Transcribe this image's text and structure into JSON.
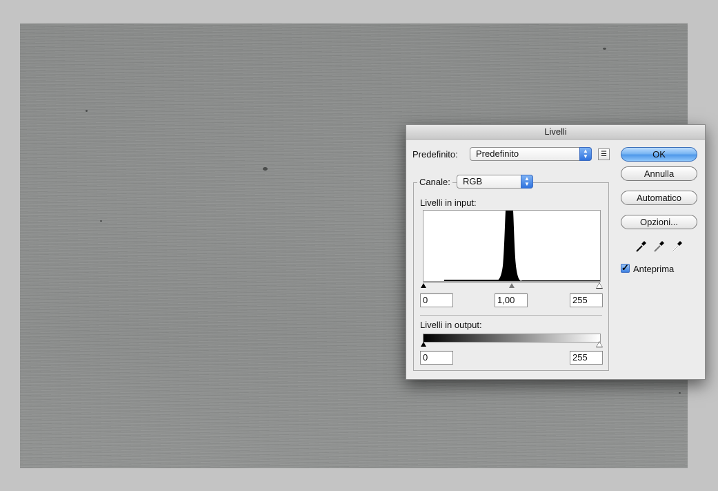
{
  "dialog": {
    "title": "Livelli",
    "preset": {
      "label": "Predefinito:",
      "value": "Predefinito"
    },
    "channel": {
      "label": "Canale:",
      "value": "RGB"
    },
    "input_levels": {
      "label": "Livelli in input:",
      "black": "0",
      "gamma": "1,00",
      "white": "255"
    },
    "output_levels": {
      "label": "Livelli in output:",
      "black": "0",
      "white": "255"
    },
    "buttons": {
      "ok": "OK",
      "cancel": "Annulla",
      "auto": "Automatico",
      "options": "Opzioni..."
    },
    "preview": {
      "label": "Anteprima",
      "checked": true
    },
    "eyedroppers": [
      "black-point-eyedropper-icon",
      "gray-point-eyedropper-icon",
      "white-point-eyedropper-icon"
    ],
    "accent_color": "#4f98ea"
  }
}
